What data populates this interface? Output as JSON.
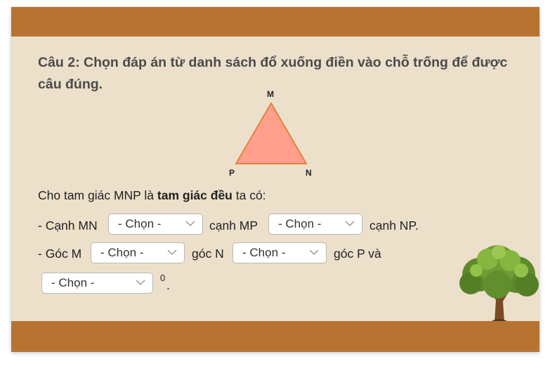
{
  "question": {
    "text": "Câu 2: Chọn đáp án từ danh sách đổ xuống điền vào chỗ trống để được câu đúng."
  },
  "figure": {
    "vertex_top": "M",
    "vertex_left": "P",
    "vertex_right": "N",
    "fill_color": "#ff9f8c",
    "stroke_color": "#e0843a"
  },
  "statement": {
    "prefix": "Cho tam giác MNP là ",
    "bold": "tam giác đều",
    "suffix": " ta có:"
  },
  "line1": {
    "part1": "- Cạnh MN",
    "part2": "cạnh MP",
    "part3": "cạnh NP."
  },
  "line2": {
    "part1": "- Góc M",
    "part2": "góc N",
    "part3": "góc P và"
  },
  "line3": {
    "degree": "0",
    "period": "."
  },
  "dropdowns": {
    "placeholder": "- Chọn -",
    "items": [
      "- Chọn -",
      "- Chọn -",
      "- Chọn -",
      "- Chọn -",
      "- Chọn -"
    ]
  },
  "colors": {
    "banner": "#b87333",
    "background": "#ede0cb",
    "question_text": "#4b4b4b"
  },
  "decoration": {
    "icon": "tree-icon"
  }
}
